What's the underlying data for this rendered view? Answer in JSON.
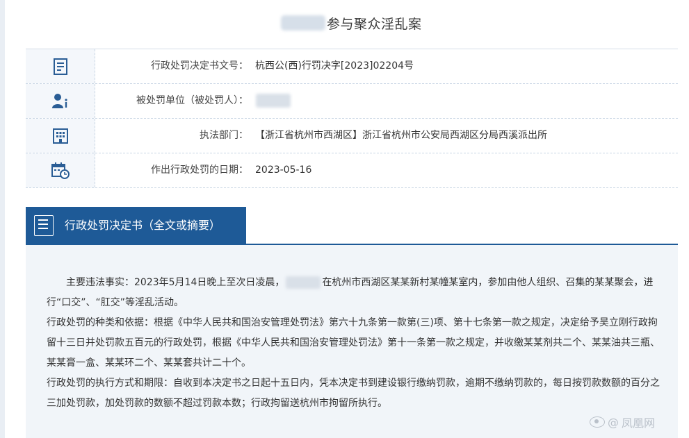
{
  "header": {
    "title": "参与聚众淫乱案"
  },
  "info_rows": [
    {
      "icon": "document-icon",
      "label": "行政处罚决定书文号：",
      "value": "杭西公(西)行罚决字[2023]02204号"
    },
    {
      "icon": "person-info-icon",
      "label": "被处罚单位（被处罚人）：",
      "value": ""
    },
    {
      "icon": "building-icon",
      "label": "执法部门：",
      "value": "【浙江省杭州市西湖区】浙江省杭州市公安局西湖区分局西溪派出所"
    },
    {
      "icon": "calendar-clock-icon",
      "label": "作出行政处罚的日期：",
      "value": "2023-05-16"
    }
  ],
  "section": {
    "icon": "document-list-icon",
    "title": "行政处罚决定书（全文或摘要）"
  },
  "content": {
    "p1_before": "主要违法事实：2023年5月14日晚上至次日凌晨，",
    "p1_after": "在杭州市西湖区某某新村某幢某室内，参加由他人组织、召集的某某聚会，进行“口交”、“肛交”等淫乱活动。",
    "p2": "行政处罚的种类和依据：根据《中华人民共和国治安管理处罚法》第六十九条第一款第(三)项、第十七条第一款之规定，决定给予吴立刚行政拘留十三日并处罚款五百元的行政处罚，根据《中华人民共和国治安管理处罚法》第十一条第一款之规定，并收缴某某剂共二个、某某油共三瓶、某某膏一盒、某某环二个、某某套共计二十个。",
    "p3": "行政处罚的执行方式和期限：自收到本决定书之日起十五日内，凭本决定书到建设银行缴纳罚款，逾期不缴纳罚款的，每日按罚款数额的百分之三加处罚款，加处罚款的数额不超过罚款本数；行政拘留送杭州市拘留所执行。"
  },
  "watermark": {
    "text": "凤凰网",
    "icon": "weibo-icon",
    "at": "@"
  },
  "colors": {
    "accent": "#1e5a97",
    "row_bg": "#f4f7fb",
    "content_bg": "#f1f5f9"
  }
}
